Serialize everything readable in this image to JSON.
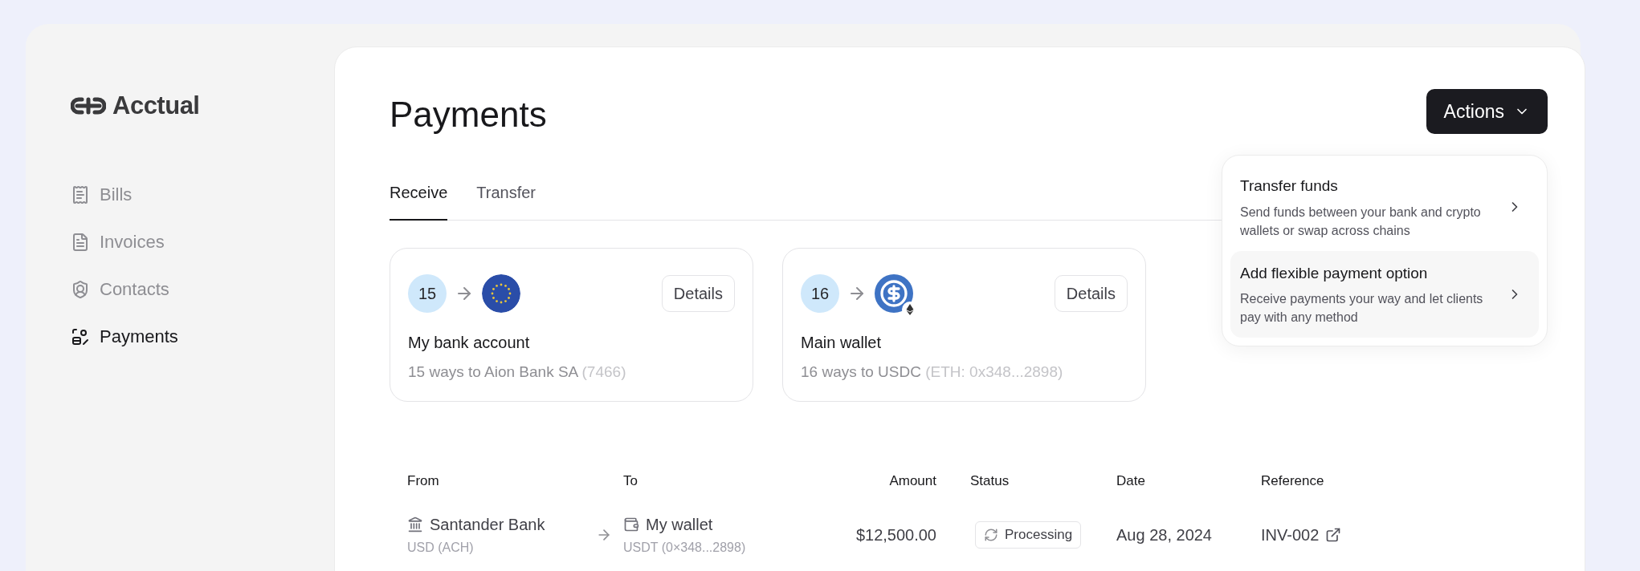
{
  "brand": {
    "name": "Acctual"
  },
  "sidebar": {
    "items": [
      {
        "label": "Bills",
        "kind": "bills",
        "selected": false
      },
      {
        "label": "Invoices",
        "kind": "invoices",
        "selected": false
      },
      {
        "label": "Contacts",
        "kind": "contacts",
        "selected": false
      },
      {
        "label": "Payments",
        "kind": "payments",
        "selected": true
      }
    ]
  },
  "page": {
    "title": "Payments"
  },
  "actions": {
    "label": "Actions",
    "expanded": true,
    "menu": [
      {
        "title": "Transfer funds",
        "description": "Send funds between your bank and crypto wallets or swap across chains",
        "highlighted": false
      },
      {
        "title": "Add flexible payment option",
        "description": "Receive payments your way and let clients pay with any method",
        "highlighted": true
      }
    ]
  },
  "tabs": [
    {
      "label": "Receive",
      "selected": true
    },
    {
      "label": "Transfer",
      "selected": false
    }
  ],
  "accounts": [
    {
      "count": "15",
      "kind": "bank",
      "button": "Details",
      "name": "My bank account",
      "subtitle": "15 ways to Aion Bank SA",
      "detail": "(7466)"
    },
    {
      "count": "16",
      "kind": "crypto",
      "button": "Details",
      "name": "Main wallet",
      "subtitle": "16 ways to USDC",
      "detail": "(ETH: 0x348...2898)"
    }
  ],
  "table": {
    "columns": [
      "From",
      "To",
      "Amount",
      "Status",
      "Date",
      "Reference"
    ],
    "rows": [
      {
        "from": "Santander Bank",
        "from_detail": "USD (ACH)",
        "to": "My wallet",
        "to_detail": "USDT (0×348...2898)",
        "amount": "$12,500.00",
        "status": "Processing",
        "date": "Aug 28, 2024",
        "reference": "INV-002"
      }
    ]
  }
}
